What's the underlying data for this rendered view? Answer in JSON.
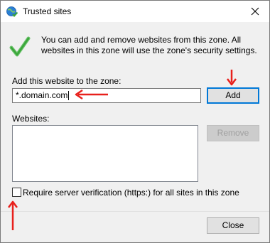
{
  "window": {
    "title": "Trusted sites"
  },
  "info": {
    "text": "You can add and remove websites from this zone. All websites in this zone will use the zone's security settings."
  },
  "add": {
    "label": "Add this website to the zone:",
    "value": "*.domain.com",
    "button_label": "Add"
  },
  "websites": {
    "label": "Websites:",
    "items": [],
    "remove_label": "Remove"
  },
  "verification": {
    "label": "Require server verification (https:) for all sites in this zone",
    "checked": false
  },
  "footer": {
    "close_label": "Close"
  },
  "icons": {
    "title": "globe-check-icon",
    "info": "green-checkmark-icon",
    "close": "close-icon",
    "annotation": "red-arrow-icon"
  },
  "colors": {
    "checkmark": "#3aa63a",
    "annotation_arrow": "#e8201c",
    "default_button_border": "#0078d7"
  }
}
